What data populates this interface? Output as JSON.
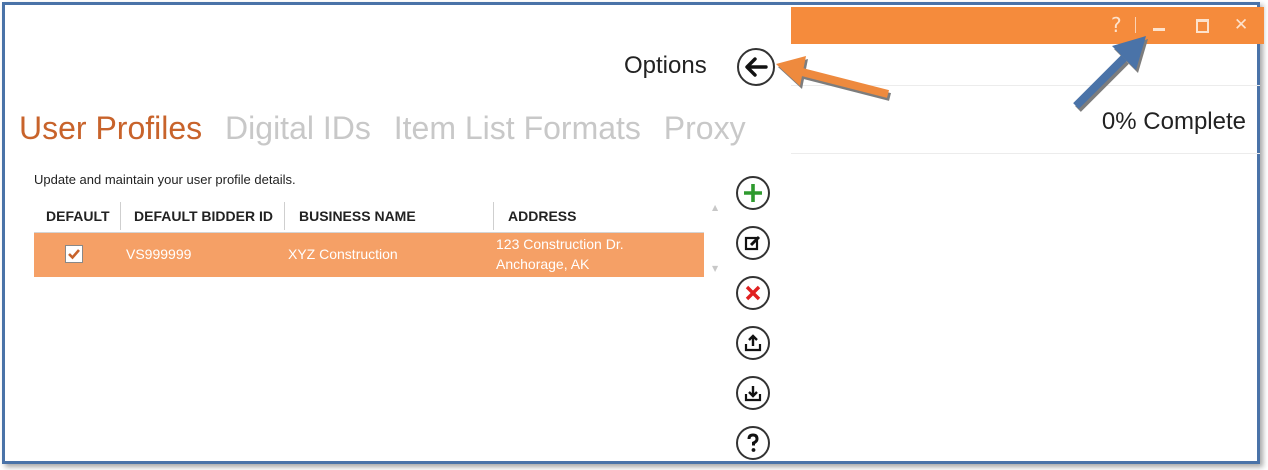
{
  "window": {
    "help_label": "?",
    "close_label": "✕"
  },
  "header": {
    "options_label": "Options",
    "back_icon": "back-arrow-icon"
  },
  "progress": {
    "status_text": "0% Complete",
    "percent": 0
  },
  "tabs": [
    {
      "label": "User Profiles",
      "active": true
    },
    {
      "label": "Digital IDs",
      "active": false
    },
    {
      "label": "Item List Formats",
      "active": false
    },
    {
      "label": "Proxy",
      "active": false
    }
  ],
  "profiles": {
    "description": "Update and maintain your user profile details.",
    "columns": [
      "DEFAULT",
      "DEFAULT BIDDER ID",
      "BUSINESS NAME",
      "ADDRESS"
    ],
    "rows": [
      {
        "default": true,
        "bidder_id": "VS999999",
        "business_name": "XYZ Construction",
        "address_line1": "123 Construction Dr.",
        "address_line2": "Anchorage, AK"
      }
    ]
  },
  "actions": [
    {
      "name": "add",
      "icon": "plus-icon"
    },
    {
      "name": "edit",
      "icon": "edit-icon"
    },
    {
      "name": "delete",
      "icon": "x-icon"
    },
    {
      "name": "export",
      "icon": "upload-icon"
    },
    {
      "name": "import",
      "icon": "download-icon"
    },
    {
      "name": "help",
      "icon": "question-icon"
    }
  ],
  "colors": {
    "accent_orange": "#f58b3c",
    "selected_row": "#f5a066",
    "active_tab": "#c8632b",
    "inactive_tab": "#c8c8c8",
    "frame_blue": "#4a73a8"
  }
}
